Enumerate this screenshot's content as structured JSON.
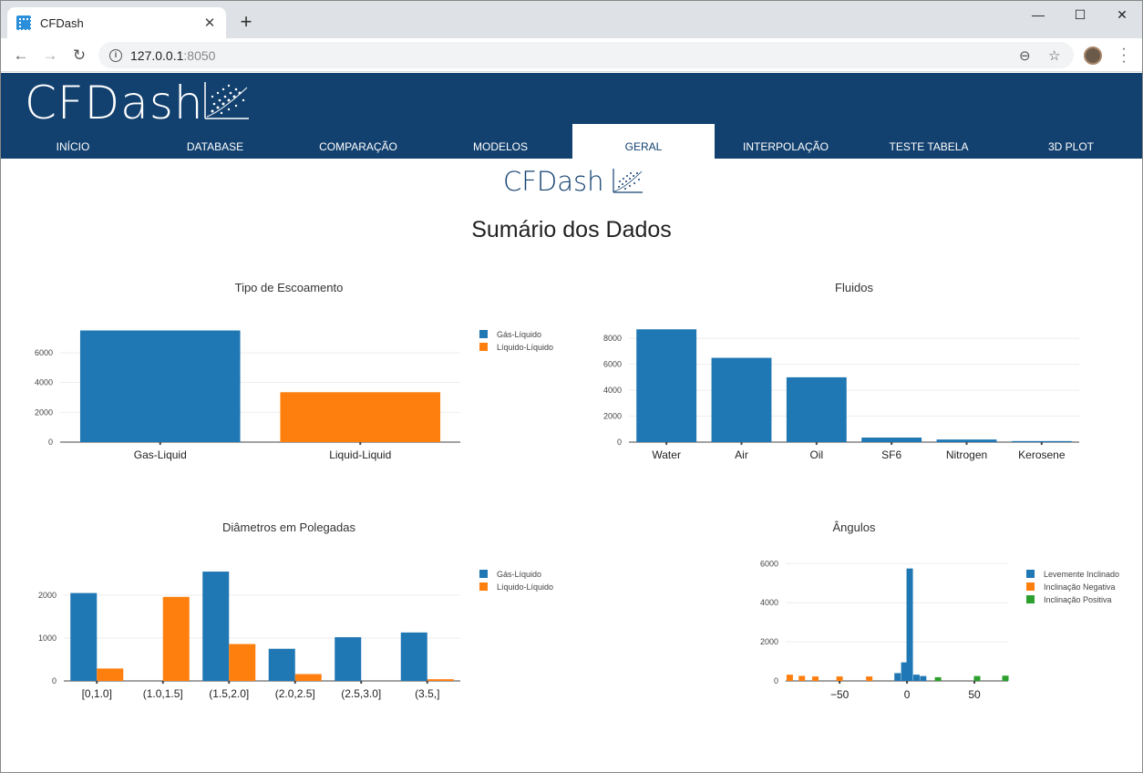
{
  "browser": {
    "tab_title": "CFDash",
    "new_tab": "+",
    "url_host": "127.0.0.1",
    "url_port": ":8050"
  },
  "app": {
    "logo_text": "CFDash",
    "nav": [
      "INÍCIO",
      "DATABASE",
      "COMPARAÇÃO",
      "MODELOS",
      "GERAL",
      "INTERPOLAÇÃO",
      "TESTE TABELA",
      "3D PLOT"
    ],
    "active_nav": "GERAL",
    "subtitle_logo": "CFDash",
    "page_title": "Sumário dos Dados"
  },
  "colors": {
    "header": "#13416f",
    "series1": "#1f77b4",
    "series2": "#ff7f0e",
    "series3": "#2ca02c"
  },
  "chart_data": [
    {
      "id": "tipo",
      "type": "bar",
      "title": "Tipo de Escoamento",
      "categories": [
        "Gas-Liquid",
        "Liquid-Liquid"
      ],
      "series": [
        {
          "name": "Gás-Líquido",
          "values": [
            7500,
            0
          ]
        },
        {
          "name": "Líquido-Líquido",
          "values": [
            0,
            3350
          ]
        }
      ],
      "ylim": [
        0,
        7900
      ],
      "yticks": [
        0,
        2000,
        4000,
        6000
      ],
      "legend": "top-right"
    },
    {
      "id": "fluidos",
      "type": "bar",
      "title": "Fluidos",
      "categories": [
        "Water",
        "Air",
        "Oil",
        "SF6",
        "Nitrogen",
        "Kerosene"
      ],
      "series": [
        {
          "name": "",
          "values": [
            8700,
            6500,
            5000,
            350,
            200,
            80
          ]
        }
      ],
      "ylim": [
        0,
        9000
      ],
      "yticks": [
        0,
        2000,
        4000,
        6000,
        8000
      ]
    },
    {
      "id": "diametros",
      "type": "bar",
      "title": "Diâmetros em Polegadas",
      "categories": [
        "[0,1.0]",
        "(1.0,1.5]",
        "(1.5,2.0]",
        "(2.0,2.5]",
        "(2.5,3.0]",
        "(3.5,]"
      ],
      "series": [
        {
          "name": "Gás-Líquido",
          "values": [
            2050,
            0,
            2550,
            750,
            1020,
            1130
          ]
        },
        {
          "name": "Líquido-Líquido",
          "values": [
            290,
            1960,
            860,
            160,
            0,
            40
          ]
        }
      ],
      "ylim": [
        0,
        2700
      ],
      "yticks": [
        0,
        1000,
        2000
      ],
      "legend": "top-right"
    },
    {
      "id": "angulos",
      "type": "bar",
      "title": "Ângulos",
      "x_ticks": [
        -50,
        0,
        50
      ],
      "xlim": [
        -90,
        75
      ],
      "series": [
        {
          "name": "Levemente Inclinado",
          "x": [
            -7,
            -2,
            2,
            7,
            12
          ],
          "values": [
            400,
            950,
            5750,
            320,
            250
          ]
        },
        {
          "name": "Inclinação Negativa",
          "x": [
            -87,
            -78,
            -68,
            -50,
            -28
          ],
          "values": [
            320,
            260,
            230,
            230,
            230
          ]
        },
        {
          "name": "Inclinação Positiva",
          "x": [
            23,
            52,
            73
          ],
          "values": [
            190,
            250,
            270
          ]
        }
      ],
      "ylim": [
        0,
        6200
      ],
      "yticks": [
        0,
        2000,
        4000,
        6000
      ],
      "legend": "top-right"
    }
  ]
}
